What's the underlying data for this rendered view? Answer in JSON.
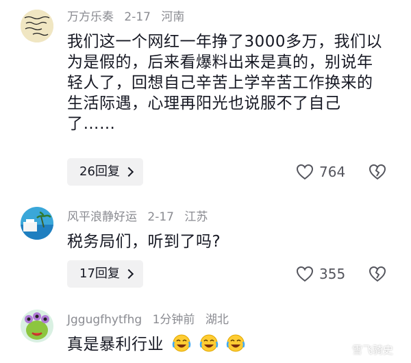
{
  "comments": [
    {
      "username": "万方乐奏",
      "date": "2-17",
      "location": "河南",
      "text": "我们这一个网红一年挣了3000多万，我们以为是假的，后来看爆料出来是真的，别说年轻人了，回想自己辛苦上学辛苦工作换来的生活际遇，心理再阳光也说服不了自己了……",
      "reply_label": "26回复",
      "likes": "764"
    },
    {
      "username": "风平浪静好运",
      "date": "2-17",
      "location": "江苏",
      "text": "税务局们，听到了吗?",
      "reply_label": "17回复",
      "likes": "355"
    },
    {
      "username": "Jggugfhytfhg",
      "date": "1分钟前",
      "location": "湖北",
      "text": "真是暴利行业",
      "emoji_icons": [
        "crying-laughing-icon",
        "crying-laughing-icon",
        "crying-laughing-icon"
      ]
    }
  ],
  "watermark": "雪飞骑史",
  "colors": {
    "meta_text": "#8a8b91",
    "body_text": "#161823",
    "reply_bg": "#f1f1f2"
  }
}
